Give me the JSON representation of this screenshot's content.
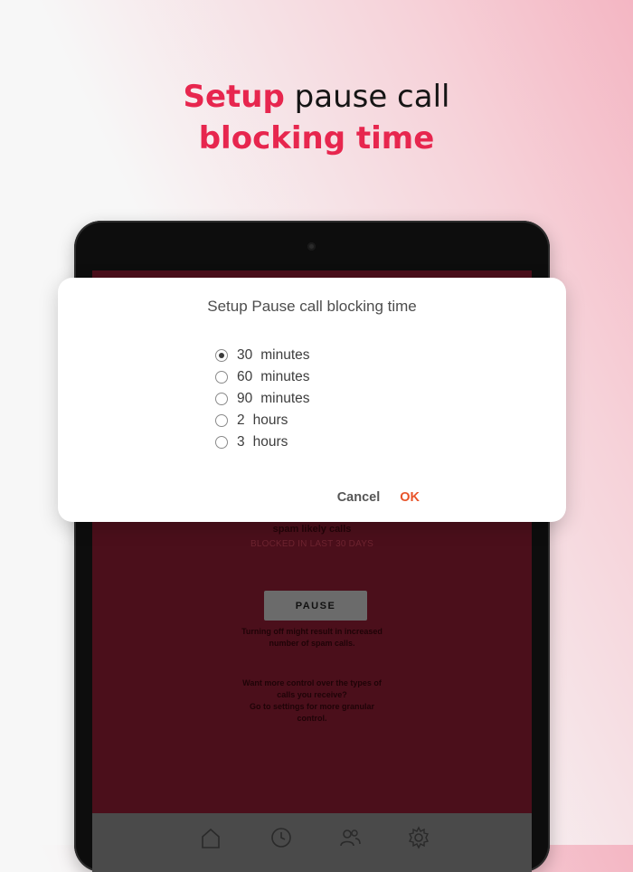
{
  "headline": {
    "line1_strong": "Setup",
    "line1_rest": " pause call",
    "line2_strong": "blocking time"
  },
  "colors": {
    "accent": "#e7264e",
    "ok": "#e8542a",
    "screen_bg": "#4b0f1b"
  },
  "dialog": {
    "title": "Setup Pause call blocking time",
    "options": [
      {
        "num": "30",
        "unit": "minutes",
        "selected": true
      },
      {
        "num": "60",
        "unit": "minutes",
        "selected": false
      },
      {
        "num": "90",
        "unit": "minutes",
        "selected": false
      },
      {
        "num": "2",
        "unit": "hours",
        "selected": false
      },
      {
        "num": "3",
        "unit": "hours",
        "selected": false
      }
    ],
    "cancel_label": "Cancel",
    "ok_label": "OK"
  },
  "screen": {
    "spam_text": "spam likely calls",
    "blocked_text": "BLOCKED IN LAST 30 DAYS",
    "pause_label": "PAUSE",
    "warn_line1": "Turning off might result in increased",
    "warn_line2": "number of spam calls.",
    "more_line1": "Want more control over the types of",
    "more_line2": "calls you receive?",
    "more_line3": "Go to settings for more granular",
    "more_line4": "control."
  },
  "tabbar": {
    "icons": [
      "home-icon",
      "clock-icon",
      "contacts-icon",
      "gear-icon"
    ]
  }
}
